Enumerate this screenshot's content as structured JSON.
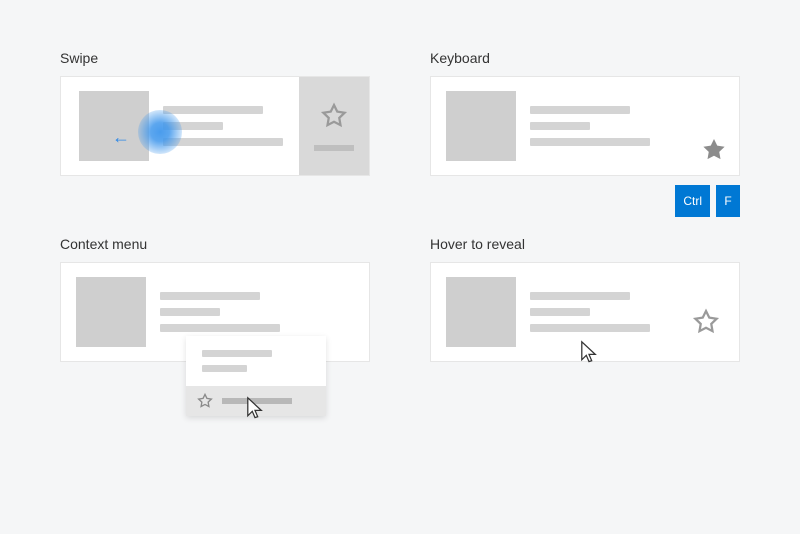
{
  "sections": {
    "swipe": {
      "title": "Swipe"
    },
    "keyboard": {
      "title": "Keyboard"
    },
    "context": {
      "title": "Context menu"
    },
    "hover": {
      "title": "Hover to reveal"
    }
  },
  "keys": {
    "ctrl": "Ctrl",
    "f": "F"
  },
  "icons": {
    "star_outline": "star-outline-icon",
    "star_filled": "star-filled-icon",
    "cursor": "cursor-icon",
    "arrow_left": "arrow-left-icon"
  }
}
